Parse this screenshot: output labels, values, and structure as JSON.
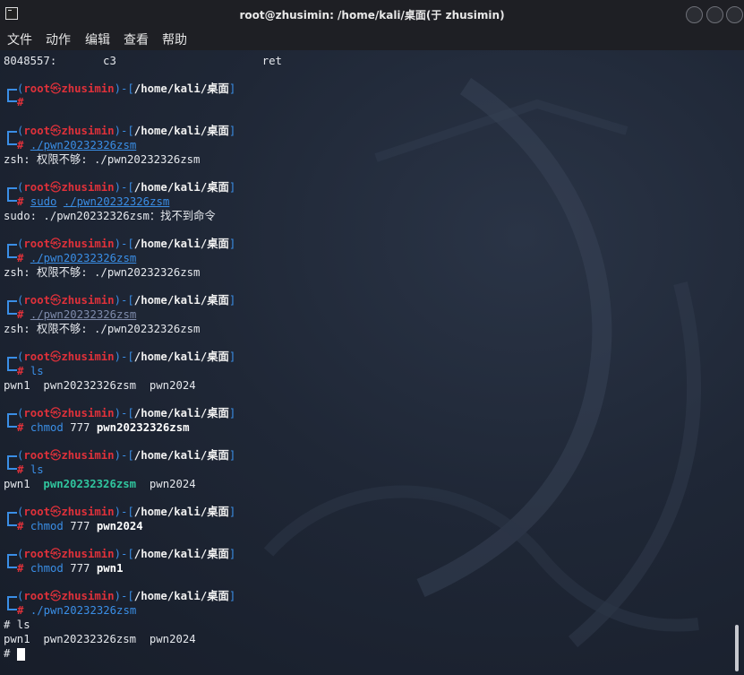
{
  "window": {
    "title": "root@zhusimin: /home/kali/桌面(于 zhusimin)"
  },
  "menu": [
    "文件",
    "动作",
    "编辑",
    "查看",
    "帮助"
  ],
  "prompt": {
    "open": "(",
    "user": "root",
    "at": "㉿",
    "host": "zhusimin",
    "close_open": ")-[",
    "path": "/home/kali/桌面",
    "close": "]",
    "hash": "#"
  },
  "lines": {
    "l0": "8048557:       c3                      ret",
    "c2": "./pwn20232326zsm",
    "o2": "zsh: 权限不够: ./pwn20232326zsm",
    "c3a": "sudo",
    "c3b": "./pwn20232326zsm",
    "o3": "sudo: ./pwn20232326zsm：找不到命令",
    "c4": "./pwn20232326zsm",
    "o4": "zsh: 权限不够: ./pwn20232326zsm",
    "c5": "./pwn20232326zsm",
    "o5": "zsh: 权限不够: ./pwn20232326zsm",
    "c6": "ls",
    "o6": "pwn1  pwn20232326zsm  pwn2024",
    "c7a": "chmod",
    "c7b": "777",
    "c7c": "pwn20232326zsm",
    "c8": "ls",
    "o8a": "pwn1  ",
    "o8b": "pwn20232326zsm",
    "o8c": "  pwn2024",
    "c9a": "chmod",
    "c9b": "777",
    "c9c": "pwn2024",
    "c10a": "chmod",
    "c10b": "777",
    "c10c": "pwn1",
    "c11": "./pwn20232326zsm",
    "o11a": "# ls",
    "o11b": "pwn1  pwn20232326zsm  pwn2024",
    "o11c": "# "
  }
}
